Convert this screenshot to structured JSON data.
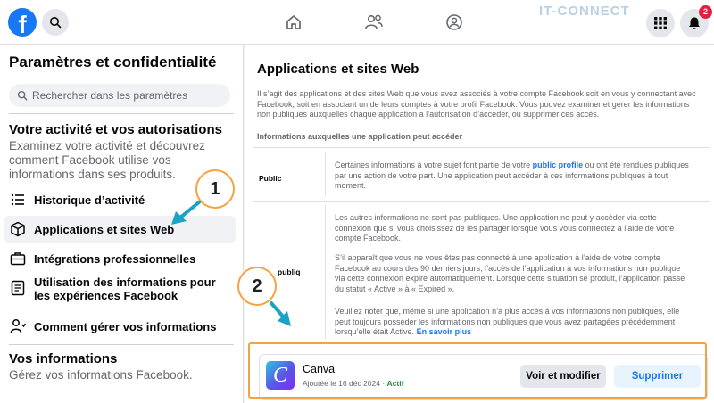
{
  "topbar": {
    "logo_letter": "f",
    "watermark": "IT-CONNECT",
    "notifications_count": "2",
    "icons": [
      "search-icon",
      "home-icon",
      "friends-icon",
      "groups-icon",
      "apps-grid-icon",
      "bell-icon"
    ]
  },
  "sidebar": {
    "title": "Paramètres et confidentialité",
    "search_placeholder": "Rechercher dans les paramètres",
    "section1": {
      "title": "Votre activité et vos autorisations",
      "description": "Examinez votre activité et découvrez comment Facebook utilise vos informations dans ses produits."
    },
    "items": [
      {
        "label": "Historique d’activité",
        "icon": "activity-list-icon"
      },
      {
        "label": "Applications et sites Web",
        "icon": "cube-icon",
        "active": true
      },
      {
        "label": "Intégrations professionnelles",
        "icon": "briefcase-icon"
      },
      {
        "label": "Utilisation des informations pour les expériences Facebook",
        "icon": "document-icon"
      },
      {
        "label": "Comment gérer vos informations",
        "icon": "person-info-icon"
      }
    ],
    "section2": {
      "title": "Vos informations",
      "description": "Gérez vos informations Facebook."
    }
  },
  "main": {
    "title": "Applications et sites Web",
    "intro": "Il s’agit des applications et des sites Web que vous avez associés à votre compte Facebook soit en vous y connectant avec Facebook, soit en associant un de leurs comptes à votre profil Facebook. Vous pouvez examiner et gérer les informations non publiques auxquelles chaque application a l’autorisation d’accéder, ou supprimer ces accès.",
    "info_heading": "Informations auxquelles une application peut accéder",
    "public_row": {
      "label": "Public",
      "text_before_link": "Certaines informations à votre sujet font partie de votre ",
      "link": "public profile",
      "text_after_link": " ou ont été rendues publiques par une action de votre part. Une application peut accéder à ces informations publiques à tout moment."
    },
    "nonpublic_row": {
      "label": "publiq",
      "p1": "Les autres informations ne sont pas publiques. Une application ne peut y accéder via cette connexion que si vous choisissez de les partager lorsque vous vous connectez à l’aide de votre compte Facebook.",
      "p2": "S’il apparaît que vous ne vous êtes pas connecté à une application à l’aide de votre compte Facebook au cours des 90 derniers jours, l’accès de l’application à vos informations non publique via cette connexion expire automatiquement. Lorsque cette situation se produit, l’application passe du statut « Active » à « Expired ».",
      "p3": "Veuillez noter que, même si une application n’a plus accès à vos informations non publiques, elle peut toujours posséder les informations non publiques que vous avez partagées précédemment lorsqu’elle était Active.",
      "learn_more": "En savoir plus"
    },
    "app_card": {
      "logo_letter": "C",
      "name": "Canva",
      "added": "Ajoutée le 16 déc 2024 · ",
      "status": "Actif",
      "view_button": "Voir et modifier",
      "delete_button": "Supprimer"
    }
  },
  "annotations": {
    "callout1": "1",
    "callout2": "2",
    "accent_color": "#f4a340",
    "arrow_color": "#1aa3c7"
  },
  "colors": {
    "facebook_blue": "#1877f2",
    "active_green": "#2b8a3e"
  }
}
